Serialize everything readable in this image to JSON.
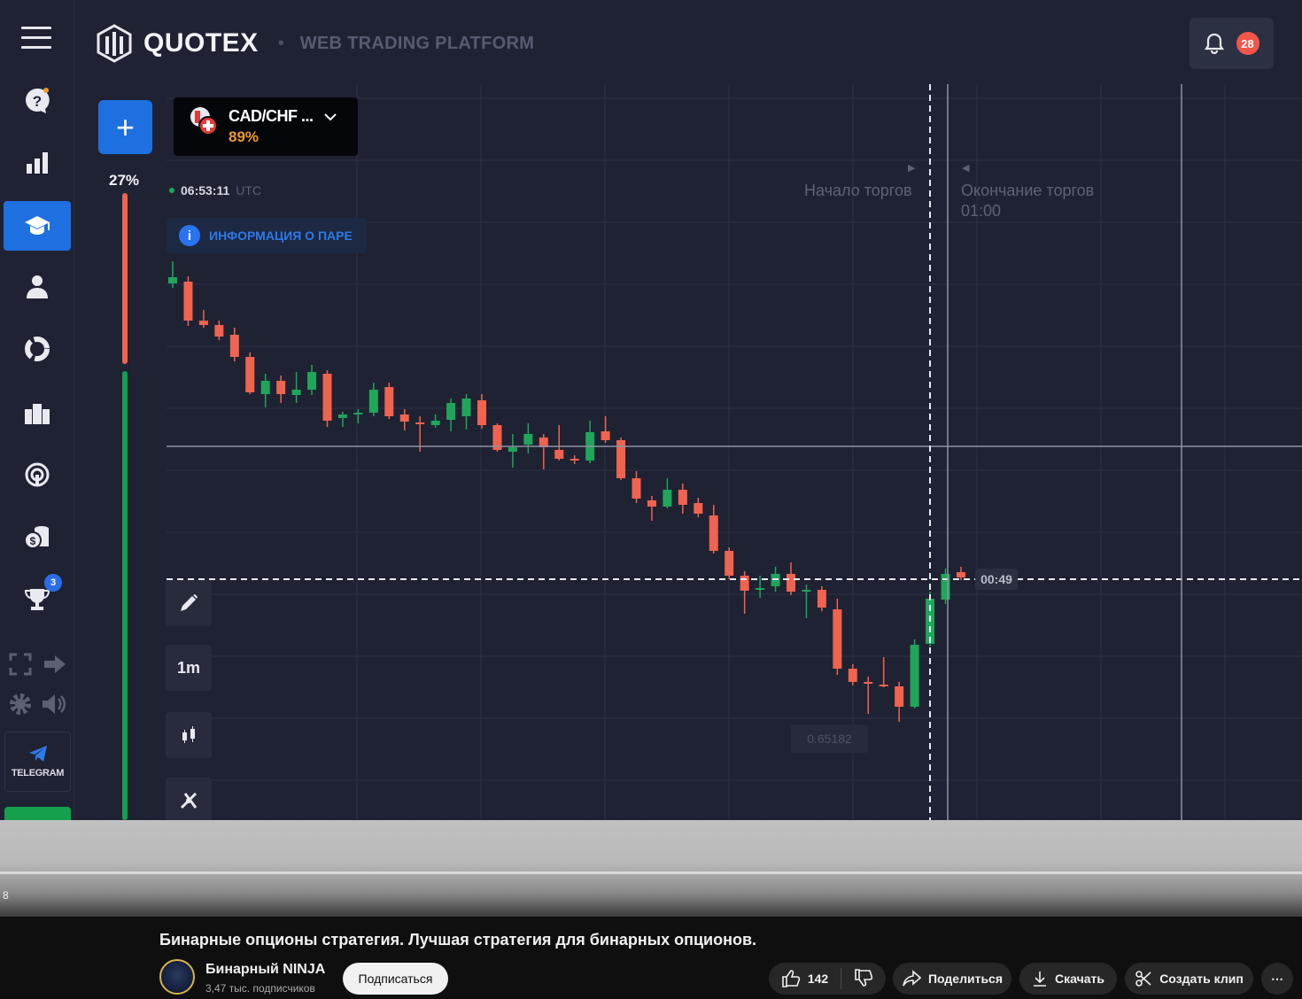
{
  "header": {
    "brand": "QUOTEX",
    "subtitle": "WEB TRADING PLATFORM",
    "notifications_count": "28"
  },
  "sidebar": {
    "items": [
      {
        "name": "help-icon"
      },
      {
        "name": "analytics-icon"
      },
      {
        "name": "education-icon",
        "active": true
      },
      {
        "name": "account-icon"
      },
      {
        "name": "market-icon"
      },
      {
        "name": "tournaments-icon"
      },
      {
        "name": "signals-icon"
      },
      {
        "name": "coins-icon"
      },
      {
        "name": "trophy-icon",
        "badge": "3"
      }
    ],
    "telegram_label": "TELEGRAM"
  },
  "trade": {
    "pair": "CAD/CHF ...",
    "payout": "89%",
    "sentiment_pct": "27%",
    "sentiment_up_fraction": 0.73,
    "time": "06:53:11",
    "timezone": "UTC",
    "pair_info": "ИНФОРМАЦИЯ О ПАРЕ",
    "trade_start": "Начало торгов",
    "trade_end": "Окончание торгов",
    "trade_end_time": "01:00",
    "timer": "00:49",
    "price_label": "0.65182",
    "timeframe": "1m"
  },
  "chart_data": {
    "type": "candlestick",
    "candles": [
      {
        "o": 320,
        "c": 313,
        "h": 295,
        "l": 325
      },
      {
        "o": 318,
        "c": 362,
        "h": 312,
        "l": 368
      },
      {
        "o": 362,
        "c": 367,
        "h": 350,
        "l": 370
      },
      {
        "o": 367,
        "c": 380,
        "h": 362,
        "l": 384
      },
      {
        "o": 378,
        "c": 403,
        "h": 370,
        "l": 408
      },
      {
        "o": 403,
        "c": 443,
        "h": 398,
        "l": 445
      },
      {
        "o": 445,
        "c": 430,
        "h": 422,
        "l": 460
      },
      {
        "o": 430,
        "c": 445,
        "h": 424,
        "l": 455
      },
      {
        "o": 446,
        "c": 440,
        "h": 420,
        "l": 455
      },
      {
        "o": 440,
        "c": 420,
        "h": 412,
        "l": 446
      },
      {
        "o": 422,
        "c": 475,
        "h": 418,
        "l": 482
      },
      {
        "o": 472,
        "c": 468,
        "h": 465,
        "l": 482
      },
      {
        "o": 468,
        "c": 466,
        "h": 462,
        "l": 478
      },
      {
        "o": 466,
        "c": 440,
        "h": 432,
        "l": 470
      },
      {
        "o": 437,
        "c": 470,
        "h": 432,
        "l": 473
      },
      {
        "o": 468,
        "c": 476,
        "h": 462,
        "l": 486
      },
      {
        "o": 477,
        "c": 478,
        "h": 470,
        "l": 510
      },
      {
        "o": 480,
        "c": 475,
        "h": 468,
        "l": 483
      },
      {
        "o": 474,
        "c": 455,
        "h": 450,
        "l": 487
      },
      {
        "o": 470,
        "c": 450,
        "h": 445,
        "l": 485
      },
      {
        "o": 452,
        "c": 480,
        "h": 445,
        "l": 484
      },
      {
        "o": 480,
        "c": 508,
        "h": 478,
        "l": 510
      },
      {
        "o": 510,
        "c": 505,
        "h": 490,
        "l": 528
      },
      {
        "o": 502,
        "c": 490,
        "h": 478,
        "l": 512
      },
      {
        "o": 494,
        "c": 505,
        "h": 490,
        "l": 530
      },
      {
        "o": 508,
        "c": 518,
        "h": 480,
        "l": 520
      },
      {
        "o": 518,
        "c": 520,
        "h": 514,
        "l": 524
      },
      {
        "o": 520,
        "c": 488,
        "h": 475,
        "l": 523
      },
      {
        "o": 487,
        "c": 497,
        "h": 470,
        "l": 500
      },
      {
        "o": 497,
        "c": 540,
        "h": 494,
        "l": 542
      },
      {
        "o": 540,
        "c": 563,
        "h": 532,
        "l": 568
      },
      {
        "o": 565,
        "c": 572,
        "h": 560,
        "l": 588
      },
      {
        "o": 572,
        "c": 553,
        "h": 540,
        "l": 574
      },
      {
        "o": 553,
        "c": 570,
        "h": 546,
        "l": 580
      },
      {
        "o": 568,
        "c": 580,
        "h": 562,
        "l": 584
      },
      {
        "o": 582,
        "c": 622,
        "h": 570,
        "l": 625
      },
      {
        "o": 622,
        "c": 650,
        "h": 618,
        "l": 654
      },
      {
        "o": 650,
        "c": 667,
        "h": 645,
        "l": 693
      },
      {
        "o": 665,
        "c": 664,
        "h": 650,
        "l": 675
      },
      {
        "o": 662,
        "c": 648,
        "h": 640,
        "l": 668
      },
      {
        "o": 648,
        "c": 668,
        "h": 635,
        "l": 672
      },
      {
        "o": 668,
        "c": 666,
        "h": 660,
        "l": 698
      },
      {
        "o": 666,
        "c": 686,
        "h": 662,
        "l": 690
      },
      {
        "o": 688,
        "c": 755,
        "h": 676,
        "l": 762
      },
      {
        "o": 755,
        "c": 770,
        "h": 750,
        "l": 774
      },
      {
        "o": 770,
        "c": 772,
        "h": 764,
        "l": 806
      },
      {
        "o": 773,
        "c": 774,
        "h": 742,
        "l": 776
      },
      {
        "o": 775,
        "c": 798,
        "h": 770,
        "l": 815
      },
      {
        "o": 798,
        "c": 728,
        "h": 722,
        "l": 800
      },
      {
        "o": 727,
        "c": 676,
        "h": 668,
        "l": 730
      },
      {
        "o": 677,
        "c": 648,
        "h": 642,
        "l": 682
      },
      {
        "o": 646,
        "c": 652,
        "h": 640,
        "l": 655
      }
    ]
  },
  "toolbar": {
    "draw": "pencil-icon",
    "timeframe": "1m",
    "chart_type": "candles-icon",
    "indicators": "indicators-icon"
  },
  "player": {
    "progress_number": "8"
  },
  "video": {
    "title": "Бинарные опционы стратегия. Лучшая стратегия для бинарных опционов.",
    "channel": "Бинарный NINJA",
    "subscribers": "3,47 тыс. подписчиков",
    "subscribe": "Подписаться",
    "likes": "142",
    "share": "Поделиться",
    "download": "Скачать",
    "clip": "Создать клип",
    "more": "⋯"
  },
  "colors": {
    "background": "#1f2233",
    "up": "#1fa65a",
    "down": "#f0634f",
    "accent": "#1e6fe0"
  }
}
